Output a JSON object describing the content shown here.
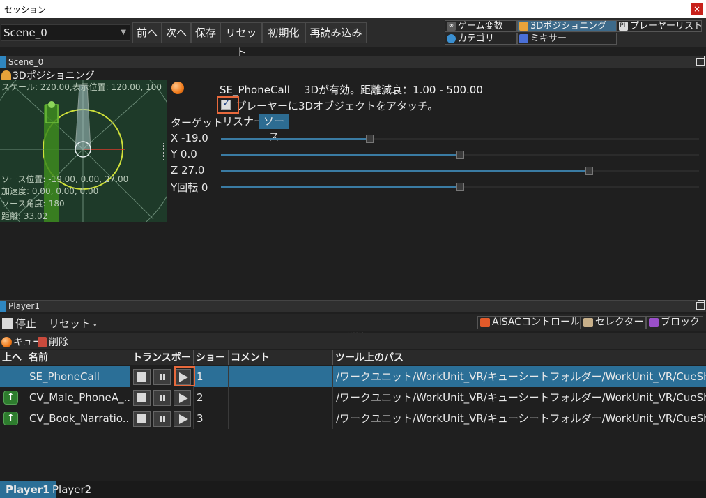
{
  "window": {
    "title": "セッション",
    "close_glyph": "×"
  },
  "toolbar": {
    "scene_select": "Scene_0",
    "buttons": [
      "前へ",
      "次へ",
      "保存",
      "リセット",
      "初期化",
      "再読み込み"
    ],
    "tabs": [
      {
        "label": "ゲーム変数",
        "icon": "game-variable-icon",
        "active": false
      },
      {
        "label": "3Dポジショニング",
        "icon": "3d-positioning-icon",
        "active": true
      },
      {
        "label": "プレーヤーリスト",
        "icon": "player-list-icon",
        "active": false
      },
      {
        "label": "カテゴリ",
        "icon": "category-icon",
        "active": false
      },
      {
        "label": "ミキサー",
        "icon": "mixer-icon",
        "active": false
      }
    ],
    "icon_text": {
      "game_variable": "∞",
      "player_list": "PL"
    }
  },
  "scene_panel": {
    "header": "Scene_0",
    "section_title": "3Dポジショニング",
    "view": {
      "scale_line": "スケール: 220.00,表示位置: 120.00, 100",
      "source_pos": "ソース位置: -19.00, 0.00, 27.00",
      "accel": "加速度: 0.00, 0.00, 0.00",
      "source_angle": "ソース角度:-180",
      "distance": "距離: 33.02"
    },
    "cue_name": "SE_PhoneCall",
    "status": "3Dが有効。距離減衰：1.00 - 500.00",
    "attach_label": "プレーヤーに3Dオブジェクトをアタッチ。",
    "attach_checked": true,
    "target_label": "ターゲット",
    "target_options": [
      "リスナー",
      "ソース"
    ],
    "target_selected": "ソース",
    "sliders": [
      {
        "label": "X -19.0",
        "fraction": 0.31
      },
      {
        "label": "Y 0.0",
        "fraction": 0.5
      },
      {
        "label": "Z 27.0",
        "fraction": 0.77
      },
      {
        "label": "Y回転 0",
        "fraction": 0.5
      }
    ]
  },
  "player_panel": {
    "header": "Player1",
    "stop_label": "停止",
    "reset_label": "リセット",
    "caret": "▾",
    "dots": "......",
    "tabs": [
      {
        "label": "AISACコントロール",
        "icon": "aisac-icon"
      },
      {
        "label": "セレクター",
        "icon": "selector-icon"
      },
      {
        "label": "ブロック",
        "icon": "block-icon"
      }
    ],
    "cue_button": "キュー",
    "delete_button": "削除",
    "columns": [
      "上へ",
      "名前",
      "トランスポート",
      "ショート",
      "コメント",
      "ツール上のパス"
    ],
    "up_glyph": "↑",
    "rows": [
      {
        "name": "SE_PhoneCall",
        "short": "1",
        "comment": "",
        "path": "/ワークユニット/WorkUnit_VR/キューシートフォルダー/WorkUnit_VR/CueSheet_VR",
        "selected": true,
        "has_up": false
      },
      {
        "name": "CV_Male_PhoneA_...",
        "short": "2",
        "comment": "",
        "path": "/ワークユニット/WorkUnit_VR/キューシートフォルダー/WorkUnit_VR/CueSheet_VR",
        "selected": false,
        "has_up": true
      },
      {
        "name": "CV_Book_Narratio...",
        "short": "3",
        "comment": "",
        "path": "/ワークユニット/WorkUnit_VR/キューシートフォルダー/WorkUnit_VR/CueSheet_VR",
        "selected": false,
        "has_up": true
      }
    ]
  },
  "bottom_tabs": [
    {
      "label": "Player1",
      "active": true
    },
    {
      "label": "Player2",
      "active": false
    }
  ],
  "colors": {
    "accent": "#2b6f97",
    "highlight": "#e8693c",
    "view_bg": "#1e3a29"
  }
}
